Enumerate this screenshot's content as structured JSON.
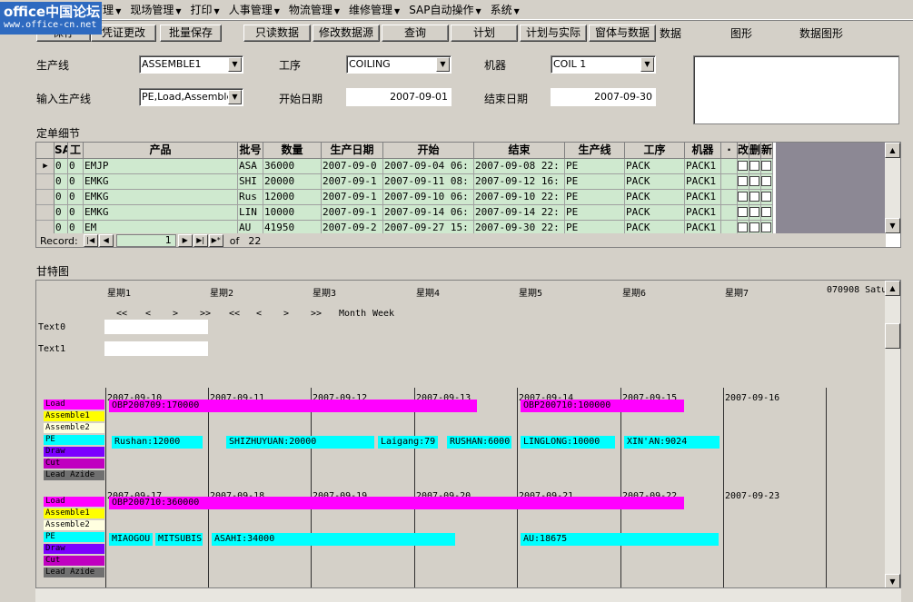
{
  "watermark": {
    "line1": "office中国论坛",
    "line2": "www.office-cn.net"
  },
  "menubar": [
    {
      "label": "文件"
    },
    {
      "label": "间管理"
    },
    {
      "label": "现场管理"
    },
    {
      "label": "打印"
    },
    {
      "label": "人事管理"
    },
    {
      "label": "物流管理"
    },
    {
      "label": "维修管理"
    },
    {
      "label": "SAP自动操作"
    },
    {
      "label": "系统"
    }
  ],
  "toolbar": {
    "save": "保存",
    "voucher": "凭证更改",
    "batch_save": "批量保存",
    "readonly": "只读数据",
    "modify_source": "修改数据源",
    "query": "查询",
    "plan": "计划",
    "plan_actual": "计划与实际",
    "form_data": "窗体与数据",
    "data": "数据",
    "graph": "图形",
    "data_graph": "数据图形"
  },
  "filters": {
    "line_label": "生产线",
    "line_value": "ASSEMBLE1",
    "process_label": "工序",
    "process_value": "COILING",
    "machine_label": "机器",
    "machine_value": "COIL 1",
    "input_line_label": "输入生产线",
    "input_line_value": "PE,Load,Assemble1",
    "start_label": "开始日期",
    "start_value": "2007-09-01",
    "end_label": "结束日期",
    "end_value": "2007-09-30"
  },
  "order_section": "定单细节",
  "grid": {
    "headers": [
      "SA",
      "工",
      "产品",
      "批号",
      "数量",
      "生产日期",
      "开始",
      "结束",
      "生产线",
      "工序",
      "机器",
      "·",
      "改",
      "删",
      "新"
    ],
    "rows": [
      [
        "0",
        "0",
        "EMJP",
        "ASA",
        "36000",
        "2007-09-0",
        "2007-09-04 06:",
        "2007-09-08 22:",
        "PE",
        "PACK",
        "PACK1"
      ],
      [
        "0",
        "0",
        "EMKG",
        "SHI",
        "20000",
        "2007-09-1",
        "2007-09-11 08:",
        "2007-09-12 16:",
        "PE",
        "PACK",
        "PACK1"
      ],
      [
        "0",
        "0",
        "EMKG",
        "Rus",
        "12000",
        "2007-09-1",
        "2007-09-10 06:",
        "2007-09-10 22:",
        "PE",
        "PACK",
        "PACK1"
      ],
      [
        "0",
        "0",
        "EMKG",
        "LIN",
        "10000",
        "2007-09-1",
        "2007-09-14 06:",
        "2007-09-14 22:",
        "PE",
        "PACK",
        "PACK1"
      ],
      [
        "0",
        "0",
        "EM",
        "AU",
        "41950",
        "2007-09-2",
        "2007-09-27 15:",
        "2007-09-30 22:",
        "PE",
        "PACK",
        "PACK1"
      ]
    ],
    "record_label": "Record:",
    "record_current": "1",
    "record_of": "of",
    "record_total": "22"
  },
  "gantt_section": "甘特图",
  "gantt": {
    "weekdays": [
      "星期1",
      "星期2",
      "星期3",
      "星期4",
      "星期5",
      "星期6",
      "星期7"
    ],
    "corner": "070908 Satu",
    "nav": [
      "<<",
      "<",
      ">",
      ">>",
      "<<",
      "<",
      ">",
      ">>"
    ],
    "month": "Month",
    "week": "Week",
    "text0": "Text0",
    "text1": "Text1",
    "categories": [
      {
        "label": "Load",
        "color": "#ff00ff"
      },
      {
        "label": "Assemble1",
        "color": "#ffff00"
      },
      {
        "label": "Assemble2",
        "color": "#ffffe0"
      },
      {
        "label": "PE",
        "color": "#00ffff"
      },
      {
        "label": "Draw",
        "color": "#7b00ff"
      },
      {
        "label": "Cut",
        "color": "#c000c0"
      },
      {
        "label": "Lead Azide",
        "color": "#707070"
      }
    ],
    "week1": {
      "dates": [
        "2007-09-10",
        "2007-09-11",
        "2007-09-12",
        "2007-09-13",
        "2007-09-14",
        "2007-09-15",
        "2007-09-16"
      ],
      "load_bars": [
        "OBP200709:170000",
        "OBP200710:100000"
      ],
      "pe_bars": [
        "Rushan:12000",
        "SHIZHUYUAN:20000",
        "Laigang:79",
        "RUSHAN:6000",
        "LINGLONG:10000",
        "XIN'AN:9024"
      ]
    },
    "week2": {
      "dates": [
        "2007-09-17",
        "2007-09-18",
        "2007-09-19",
        "2007-09-20",
        "2007-09-21",
        "2007-09-22",
        "2007-09-23"
      ],
      "load_bars": [
        "OBP200710:360000"
      ],
      "pe_bars": [
        "MIAOGOU",
        "MITSUBIS",
        "ASAHI:34000",
        "AU:18675"
      ]
    }
  }
}
